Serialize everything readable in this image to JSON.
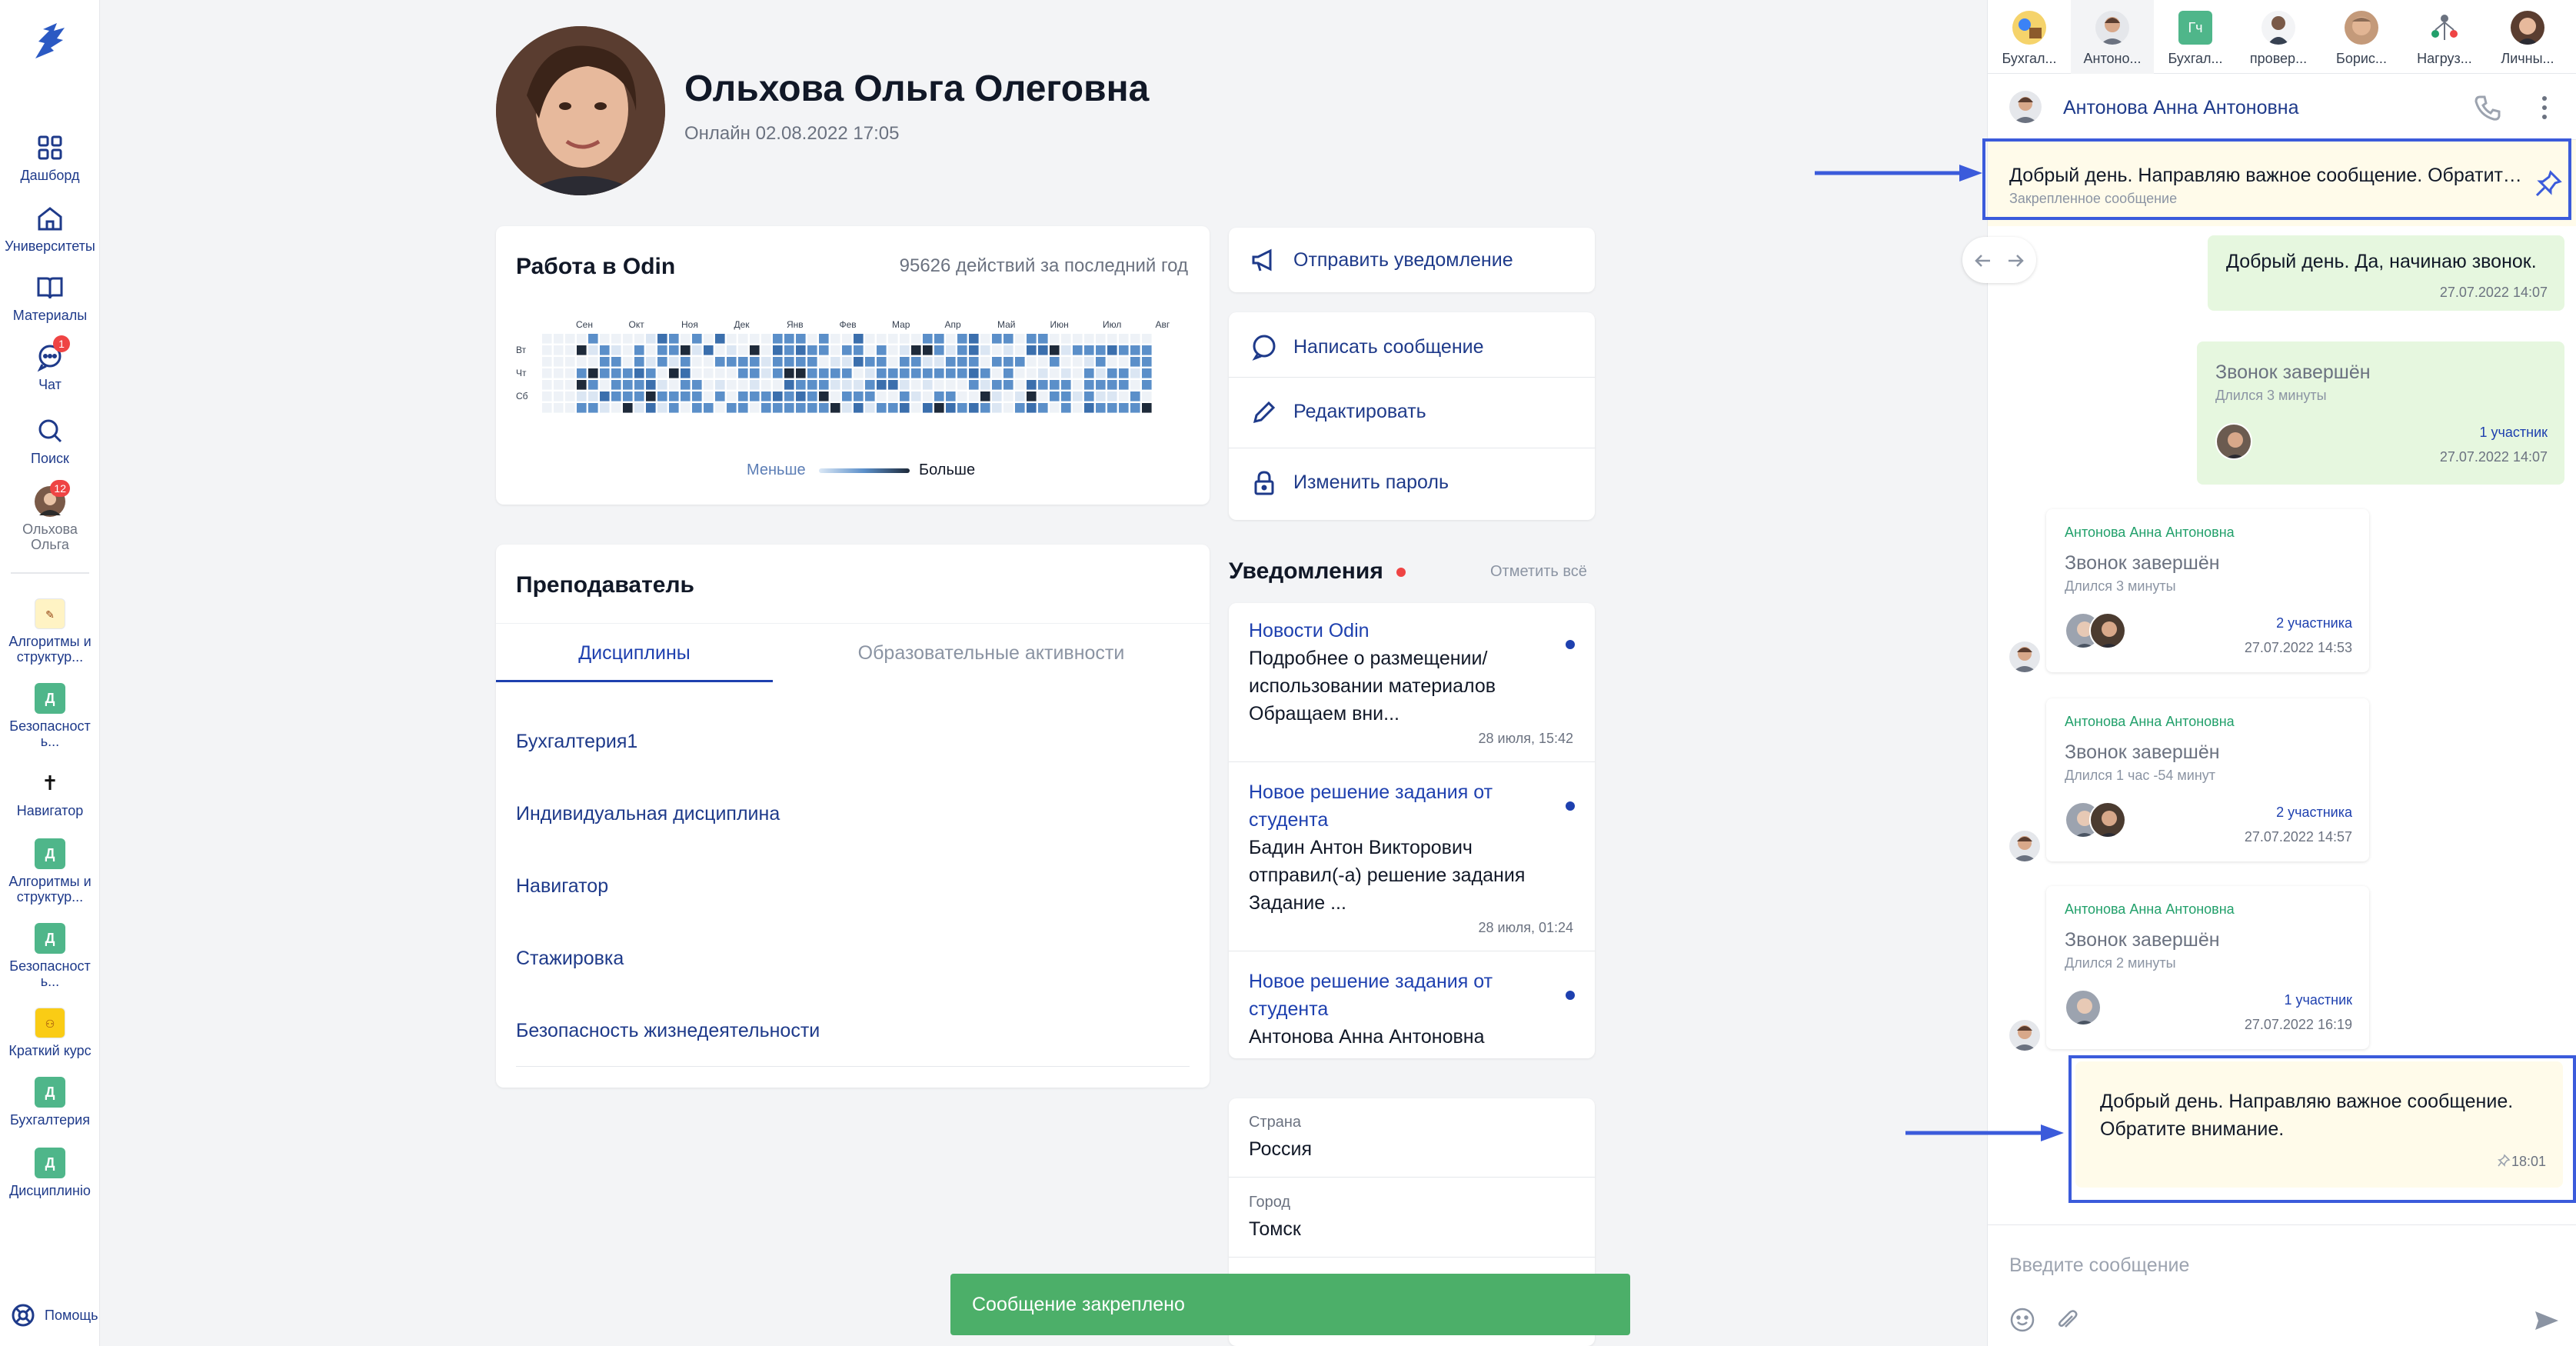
{
  "nav": {
    "items": [
      {
        "label": "Дашборд",
        "icon": "grid-icon"
      },
      {
        "label": "Университеты",
        "icon": "university-icon"
      },
      {
        "label": "Материалы",
        "icon": "book-icon"
      },
      {
        "label": "Чат",
        "icon": "chat-icon",
        "badge": "1"
      },
      {
        "label": "Поиск",
        "icon": "search-icon"
      },
      {
        "label": "Ольхова Ольга",
        "icon": "avatar",
        "badge": "12"
      }
    ],
    "courses": [
      {
        "label": "Алгоритмы и структур...",
        "mark": "✎"
      },
      {
        "label": "Безопасност ь...",
        "mark": "Д"
      },
      {
        "label": "Навигатор",
        "mark": "✝"
      },
      {
        "label": "Алгоритмы и структур...",
        "mark": "Д"
      },
      {
        "label": "Безопасност ь...",
        "mark": "Д"
      },
      {
        "label": "Краткий курс",
        "mark": "⚇"
      },
      {
        "label": "Бухгалтерия",
        "mark": "Д"
      },
      {
        "label": "Дисциплинio",
        "mark": "Д"
      }
    ],
    "help": "Помощь"
  },
  "profile": {
    "name": "Ольхова Ольга Олеговна",
    "status": "Онлайн 02.08.2022 17:05"
  },
  "activity": {
    "title": "Работа в Odin",
    "count": "95626 действий за последний год",
    "months": [
      "Сен",
      "Окт",
      "Ноя",
      "Дек",
      "Янв",
      "Фев",
      "Мар",
      "Апр",
      "Май",
      "Июн",
      "Июл",
      "Авг"
    ],
    "days": [
      "Вт",
      "Чт",
      "Сб"
    ],
    "legend_less": "Меньше",
    "legend_more": "Больше"
  },
  "actions": {
    "notify": "Отправить уведомление",
    "message": "Написать сообщение",
    "edit": "Редактировать",
    "password": "Изменить пароль"
  },
  "teacher": {
    "title": "Преподаватель",
    "tab_disciplines": "Дисциплины",
    "tab_activities": "Образовательные активности",
    "disciplines": [
      "Бухгалтерия1",
      "Индивидуальная дисциплина",
      "Навигатор",
      "Стажировка",
      "Безопасность жизнедеятельности"
    ]
  },
  "notifications": {
    "title": "Уведомления",
    "mark_all": "Отметить всё",
    "items": [
      {
        "title": "Новости Odin",
        "body": "Подробнее о размещении/ использовании материалов Обращаем вни...",
        "date": "28 июля, 15:42"
      },
      {
        "title": "Новое решение задания от студента",
        "body": "Бадин Антон Викторович отправил(-а) решение задания Задание ...",
        "date": "28 июля, 01:24"
      },
      {
        "title": "Новое решение задания от студента",
        "body": "Антонова Анна Антоновна",
        "date": ""
      }
    ]
  },
  "info": {
    "country_label": "Страна",
    "country": "Россия",
    "city_label": "Город",
    "city": "Томск"
  },
  "toast": "Сообщение закреплено",
  "chat": {
    "tabs": [
      "Бухгал...",
      "Антоно...",
      "Бухгал...",
      "провер...",
      "Борис...",
      "Нагруз...",
      "Личны..."
    ],
    "tab3_initials": "Гч",
    "contact": "Антонова Анна Антоновна",
    "pinned_text": "Добрый день. Направляю важное сообщение. Обратите внимание.",
    "pinned_label": "Закрепленное сообщение",
    "messages": {
      "m1_text": "Добрый день. Да, начинаю звонок.",
      "m1_time": "27.07.2022 14:07",
      "m2_call": "Звонок завершён",
      "m2_dur": "Длился 3 минуты",
      "m2_part": "1 участник",
      "m2_time": "27.07.2022 14:07",
      "m3_sender": "Антонова Анна Антоновна",
      "m3_call": "Звонок завершён",
      "m3_dur": "Длился 3 минуты",
      "m3_part": "2 участника",
      "m3_time": "27.07.2022 14:53",
      "m4_sender": "Антонова Анна Антоновна",
      "m4_call": "Звонок завершён",
      "m4_dur": "Длился 1 час -54 минут",
      "m4_part": "2 участника",
      "m4_time": "27.07.2022 14:57",
      "m5_sender": "Антонова Анна Антоновна",
      "m5_call": "Звонок завершён",
      "m5_dur": "Длился 2 минуты",
      "m5_part": "1 участник",
      "m5_time": "27.07.2022 16:19",
      "m6_text_1": "Добрый день. Направляю важное сообщение.",
      "m6_text_2": "Обратите внимание.",
      "m6_time": "18:01"
    },
    "input_placeholder": "Введите сообщение"
  },
  "colors": {
    "accent": "#1e40af",
    "highlight": "#3b5bdb",
    "toast": "#4caf69",
    "mine_bubble": "#e6f7df",
    "pinned_bg": "#fffbea"
  }
}
